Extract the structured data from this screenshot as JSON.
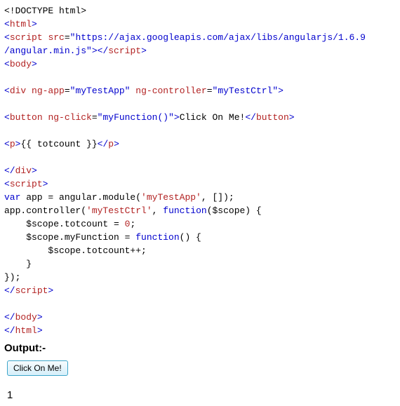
{
  "code": {
    "l1a": "<!DOCTYPE html>",
    "l2_open": "<",
    "l2_tag": "html",
    "l2_close": ">",
    "l3_open": "<",
    "l3_tag": "script",
    "l3_sp": " ",
    "l3_attr": "src",
    "l3_eq": "=",
    "l3_val": "\"https://ajax.googleapis.com/ajax/libs/angularjs/1.6.9",
    "l4_val": "/angular.min.js\"",
    "l4_gt": ">",
    "l4_open2": "</",
    "l4_tag2": "script",
    "l4_close2": ">",
    "l5_open": "<",
    "l5_tag": "body",
    "l5_close": ">",
    "l7_open": "<",
    "l7_tag": "div",
    "l7_sp": " ",
    "l7_attr1": "ng-app",
    "l7_eq1": "=",
    "l7_val1": "\"myTestApp\"",
    "l7_sp2": " ",
    "l7_attr2": "ng-controller",
    "l7_eq2": "=",
    "l7_val2": "\"myTestCtrl\"",
    "l7_close": ">",
    "l9_open": "<",
    "l9_tag": "button",
    "l9_sp": " ",
    "l9_attr": "ng-click",
    "l9_eq": "=",
    "l9_val": "\"myFunction()\"",
    "l9_gt": ">",
    "l9_text": "Click On Me!",
    "l9_open2": "</",
    "l9_tag2": "button",
    "l9_close2": ">",
    "l11_open": "<",
    "l11_tag": "p",
    "l11_gt": ">",
    "l11_text": "{{ totcount }}",
    "l11_open2": "</",
    "l11_tag2": "p",
    "l11_close2": ">",
    "l13_open": "</",
    "l13_tag": "div",
    "l13_close": ">",
    "l14_open": "<",
    "l14_tag": "script",
    "l14_close": ">",
    "l15_a": "var",
    "l15_b": " app = angular.module(",
    "l15_c": "'myTestApp'",
    "l15_d": ", []);",
    "l16_a": "app.controller(",
    "l16_b": "'myTestCtrl'",
    "l16_c": ", ",
    "l16_d": "function",
    "l16_e": "($scope) {",
    "l17": "    $scope.totcount = ",
    "l17_num": "0",
    "l17_end": ";",
    "l18_a": "    $scope.myFunction = ",
    "l18_b": "function",
    "l18_c": "() {",
    "l19": "        $scope.totcount++;",
    "l20": "    }",
    "l21": "});",
    "l22_open": "</",
    "l22_tag": "script",
    "l22_close": ">",
    "l24_open": "</",
    "l24_tag": "body",
    "l24_close": ">",
    "l25_open": "</",
    "l25_tag": "html",
    "l25_close": ">"
  },
  "output": {
    "label": "Output:-",
    "button_label": "Click On Me!",
    "count": "1"
  }
}
